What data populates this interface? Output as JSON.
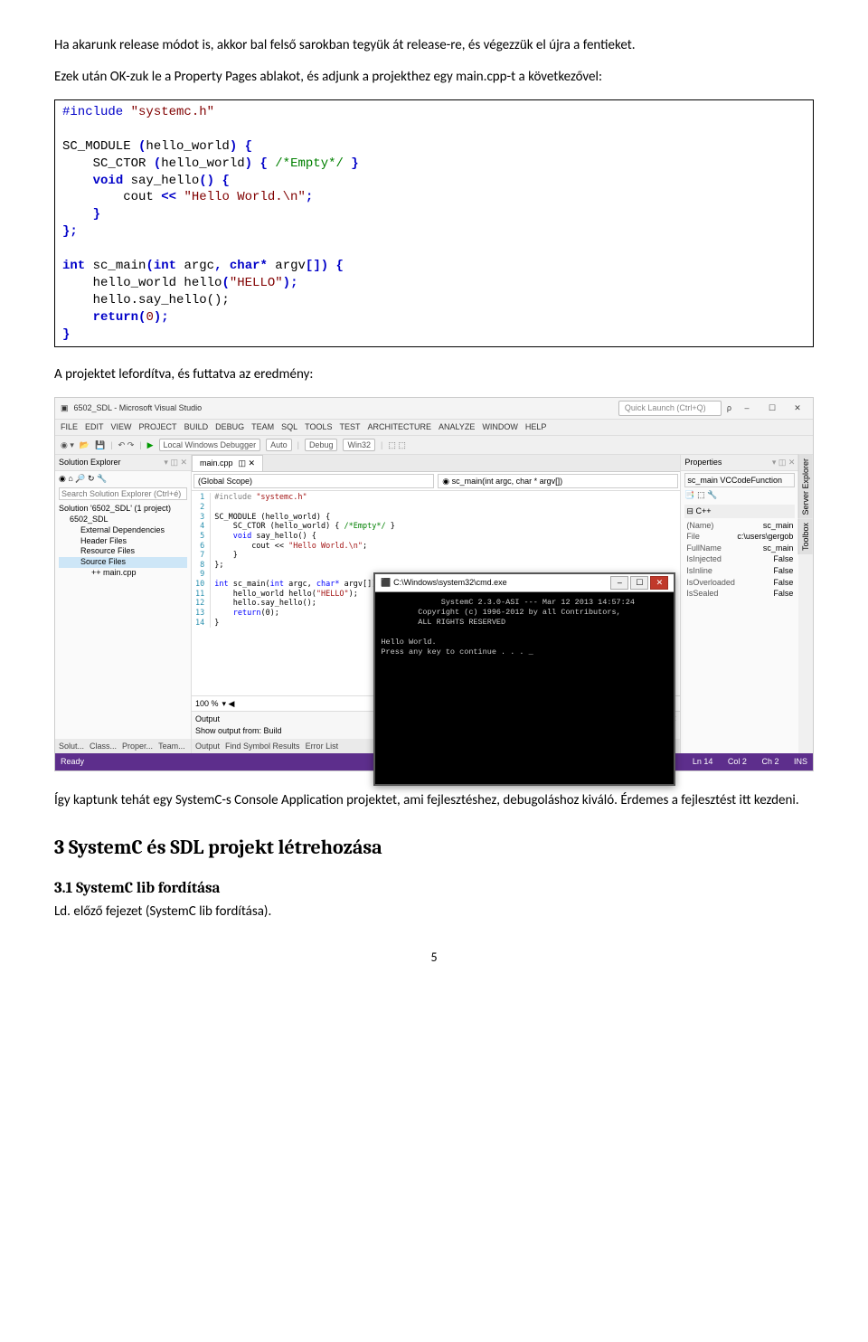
{
  "para1": "Ha akarunk release módot is, akkor bal felső sarokban tegyük át release-re, és végezzük el újra a fentieket.",
  "para2": "Ezek után OK-zuk le a Property Pages ablakot, és adjunk a projekthez egy main.cpp-t a következővel:",
  "code": {
    "l1_pp": "#include ",
    "l1_str": "\"systemc.h\"",
    "l3a": "SC_MODULE ",
    "l3b": "(",
    "l3c": "hello_world",
    "l3d": ")",
    "l3e": " {",
    "l4a": "    SC_CTOR ",
    "l4b": "(",
    "l4c": "hello_world",
    "l4d": ")",
    "l4e": " { ",
    "l4cm": "/*Empty*/",
    "l4f": " }",
    "l5a": "    ",
    "l5kw": "void",
    "l5b": " say_hello",
    "l5c": "()",
    "l5d": " {",
    "l6a": "        cout ",
    "l6b": "<<",
    "l6c": " ",
    "l6str": "\"Hello World.\\n\"",
    "l6d": ";",
    "l7": "    }",
    "l8": "};",
    "l10a": "int",
    "l10b": " sc_main",
    "l10c": "(",
    "l10d": "int",
    "l10e": " argc",
    "l10f": ",",
    "l10g": " ",
    "l10h": "char*",
    "l10i": " argv",
    "l10j": "[])",
    "l10k": " {",
    "l11a": "    hello_world hello",
    "l11b": "(",
    "l11str": "\"HELLO\"",
    "l11c": ")",
    "l11d": ";",
    "l12": "    hello.say_hello();",
    "l13a": "    ",
    "l13kw": "return",
    "l13b": "(",
    "l13n": "0",
    "l13c": ")",
    "l13d": ";",
    "l14": "}"
  },
  "para3": "A projektet lefordítva, és futtatva az eredmény:",
  "vs": {
    "title": "6502_SDL - Microsoft Visual Studio",
    "quick_launch_ph": "Quick Launch (Ctrl+Q)",
    "menu": [
      "FILE",
      "EDIT",
      "VIEW",
      "PROJECT",
      "BUILD",
      "DEBUG",
      "TEAM",
      "SQL",
      "TOOLS",
      "TEST",
      "ARCHITECTURE",
      "ANALYZE",
      "WINDOW",
      "HELP"
    ],
    "toolbar": {
      "debugger": "Local Windows Debugger",
      "launch_mode": "Auto",
      "config": "Debug",
      "platform": "Win32"
    },
    "solution_explorer": {
      "title": "Solution Explorer",
      "search_ph": "Search Solution Explorer (Ctrl+é)",
      "items": [
        {
          "lvl": 1,
          "txt": "Solution '6502_SDL' (1 project)"
        },
        {
          "lvl": 2,
          "txt": "6502_SDL"
        },
        {
          "lvl": 3,
          "txt": "External Dependencies"
        },
        {
          "lvl": 3,
          "txt": "Header Files"
        },
        {
          "lvl": 3,
          "txt": "Resource Files"
        },
        {
          "lvl": 3,
          "txt": "Source Files",
          "sel": true
        },
        {
          "lvl": 4,
          "txt": "++ main.cpp"
        }
      ],
      "bottom_tabs": [
        "Solut...",
        "Class...",
        "Proper...",
        "Team..."
      ]
    },
    "editor": {
      "tab": "main.cpp",
      "scope_left": "(Global Scope)",
      "scope_right": "sc_main(int argc, char * argv[])",
      "lines": [
        "1",
        "2",
        "3",
        "4",
        "5",
        "6",
        "7",
        "8",
        "9",
        "10",
        "11",
        "12",
        "13",
        "14"
      ],
      "code_html": [
        {
          "pp": "#include ",
          "str": "\"systemc.h\""
        },
        {
          "plain": ""
        },
        {
          "plain": "SC_MODULE (hello_world) {"
        },
        {
          "plain": "    SC_CTOR (hello_world) { ",
          "cm": "/*Empty*/",
          "tail": " }"
        },
        {
          "plain": "    ",
          "kw": "void",
          "mid": " say_hello() {"
        },
        {
          "plain": "        cout << ",
          "str": "\"Hello World.\\n\"",
          "tail": ";"
        },
        {
          "plain": "    }"
        },
        {
          "plain": "};"
        },
        {
          "plain": ""
        },
        {
          "kw": "int",
          "mid": " sc_main(",
          "kw2": "int",
          "mid2": " argc, ",
          "kw3": "char*",
          "tail": " argv[]) {"
        },
        {
          "plain": "    hello_world hello(",
          "str": "\"HELLO\"",
          "tail": ");"
        },
        {
          "plain": "    hello.say_hello();"
        },
        {
          "plain": "    ",
          "kw": "return",
          "tail": "(0);"
        },
        {
          "plain": "}"
        }
      ],
      "zoom": "100 %",
      "output_title": "Output",
      "output_from": "Show output from: Build",
      "bottom_tabs": [
        "Output",
        "Find Symbol Results",
        "Error List"
      ]
    },
    "properties": {
      "title": "Properties",
      "sub": "sc_main VCCodeFunction",
      "group": "C++",
      "rows": [
        {
          "k": "(Name)",
          "v": "sc_main"
        },
        {
          "k": "File",
          "v": "c:\\users\\gergob"
        },
        {
          "k": "FullName",
          "v": "sc_main"
        },
        {
          "k": "IsInjected",
          "v": "False"
        },
        {
          "k": "IsInline",
          "v": "False"
        },
        {
          "k": "IsOverloaded",
          "v": "False"
        },
        {
          "k": "IsSealed",
          "v": "False"
        }
      ]
    },
    "side_tabs": [
      "Server Explorer",
      "Toolbox"
    ],
    "console": {
      "title": "C:\\Windows\\system32\\cmd.exe",
      "body": "             SystemC 2.3.0-ASI --- Mar 12 2013 14:57:24\n        Copyright (c) 1996-2012 by all Contributors,\n        ALL RIGHTS RESERVED\n\nHello World.\nPress any key to continue . . . _"
    },
    "status": {
      "left": "Ready",
      "ln": "Ln 14",
      "col": "Col 2",
      "ch": "Ch 2",
      "ins": "INS"
    }
  },
  "para4": "Így kaptunk tehát egy SystemC-s Console Application projektet, ami fejlesztéshez, debugoláshoz kiváló. Érdemes a fejlesztést itt kezdeni.",
  "h3": "3   SystemC és SDL projekt létrehozása",
  "h31": "3.1   SystemC lib fordítása",
  "para5": "Ld. előző fejezet (SystemC lib fordítása).",
  "pagenum": "5"
}
